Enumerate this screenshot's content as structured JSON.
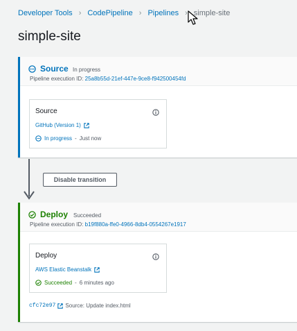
{
  "breadcrumb": {
    "items": [
      "Developer Tools",
      "CodePipeline",
      "Pipelines"
    ],
    "current": "simple-site"
  },
  "page": {
    "title": "simple-site"
  },
  "colors": {
    "link": "#0073bb",
    "in_progress": "#0073bb",
    "succeeded": "#1d8102"
  },
  "stages": {
    "source": {
      "name": "Source",
      "status": "In progress",
      "execution_label": "Pipeline execution ID:",
      "execution_id": "25a8b55d-21ef-447e-9ce8-f942500454fd",
      "action": {
        "name": "Source",
        "provider": "GitHub (Version 1)",
        "status": "In progress",
        "time": "Just now",
        "status_icon": "in-progress-icon"
      }
    },
    "deploy": {
      "name": "Deploy",
      "status": "Succeeded",
      "execution_label": "Pipeline execution ID:",
      "execution_id": "b19f880a-ffe0-4966-8db4-0554267e1917",
      "action": {
        "name": "Deploy",
        "provider": "AWS Elastic Beanstalk",
        "status": "Succeeded",
        "time": "6 minutes ago",
        "status_icon": "success-icon"
      },
      "revision": {
        "commit": "cfc72e97",
        "text": "Source: Update index.html"
      }
    }
  },
  "transition": {
    "button_label": "Disable transition"
  }
}
